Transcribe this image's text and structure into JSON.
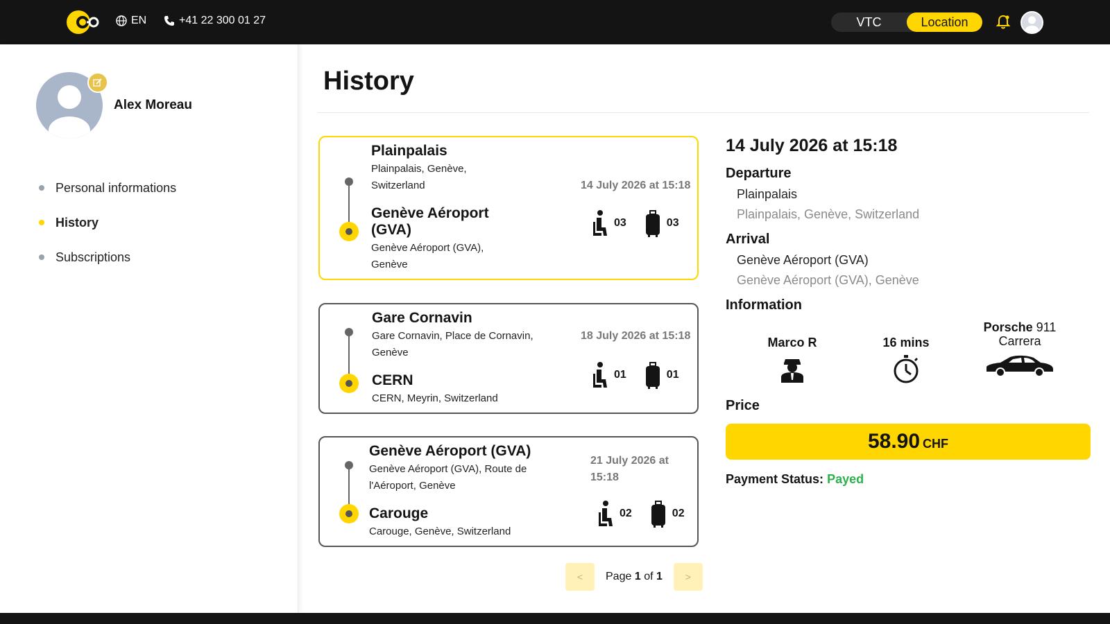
{
  "header": {
    "language": "EN",
    "phone": "+41 22 300 01 27",
    "modes": [
      "VTC",
      "Location"
    ],
    "active_mode": "Location",
    "accent_color": "#FFD600"
  },
  "user": {
    "name": "Alex Moreau"
  },
  "sidebar": {
    "items": [
      {
        "label": "Personal informations",
        "active": false
      },
      {
        "label": "History",
        "active": true
      },
      {
        "label": "Subscriptions",
        "active": false
      }
    ]
  },
  "page": {
    "title": "History"
  },
  "rides": [
    {
      "from_name": "Plainpalais",
      "from_address": "Plainpalais, Genève, Switzerland",
      "to_name": "Genève Aéroport (GVA)",
      "to_address": "Genève Aéroport (GVA), Genève",
      "date": "14 July 2026 at 15:18",
      "passengers": "03",
      "luggage": "03",
      "selected": true
    },
    {
      "from_name": "Gare Cornavin",
      "from_address": "Gare Cornavin, Place de Cornavin, Genève",
      "to_name": "CERN",
      "to_address": "CERN, Meyrin, Switzerland",
      "date": "18 July 2026 at 15:18",
      "passengers": "01",
      "luggage": "01",
      "selected": false
    },
    {
      "from_name": "Genève Aéroport (GVA)",
      "from_address": "Genève Aéroport (GVA), Route de l'Aéroport, Genève",
      "to_name": "Carouge",
      "to_address": "Carouge, Genève, Switzerland",
      "date": "21 July 2026 at 15:18",
      "passengers": "02",
      "luggage": "02",
      "selected": false
    }
  ],
  "pagination": {
    "prev": "<",
    "next": ">",
    "page_word": "Page",
    "of_word": "of",
    "current": "1",
    "total": "1"
  },
  "detail": {
    "date": "14 July 2026 at 15:18",
    "departure_label": "Departure",
    "departure_name": "Plainpalais",
    "departure_address": "Plainpalais, Genève, Switzerland",
    "arrival_label": "Arrival",
    "arrival_name": "Genève Aéroport (GVA)",
    "arrival_address": "Genève Aéroport (GVA), Genève",
    "information_label": "Information",
    "driver": "Marco R",
    "duration": "16 mins",
    "car_make": "Porsche",
    "car_model": "911",
    "car_variant": "Carrera",
    "price_label": "Price",
    "price": "58.90",
    "currency": "CHF",
    "payment_label": "Payment Status:",
    "payment_status": "Payed",
    "payment_color": "#2bb24c"
  }
}
